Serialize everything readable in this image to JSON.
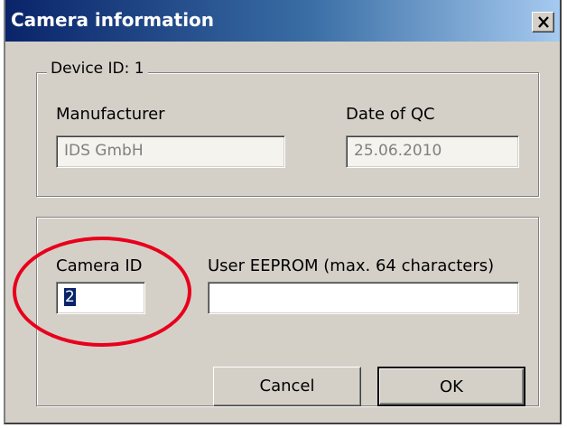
{
  "window": {
    "title": "Camera information"
  },
  "device_group": {
    "legend": "Device ID: 1",
    "manufacturer_label": "Manufacturer",
    "manufacturer_value": "IDS GmbH",
    "qc_label": "Date of QC",
    "qc_value": "25.06.2010"
  },
  "camera_group": {
    "camera_id_label": "Camera ID",
    "camera_id_value": "2",
    "eeprom_label": "User EEPROM (max. 64 characters)",
    "eeprom_value": ""
  },
  "buttons": {
    "cancel": "Cancel",
    "ok": "OK"
  },
  "colors": {
    "title_bar_start": "#0a246a",
    "title_bar_end": "#a6caf0",
    "dialog_background": "#d4d0c8",
    "annotation_circle": "#e8001c",
    "selection_highlight": "#0a246a"
  },
  "icons": {
    "close": "close-icon"
  }
}
